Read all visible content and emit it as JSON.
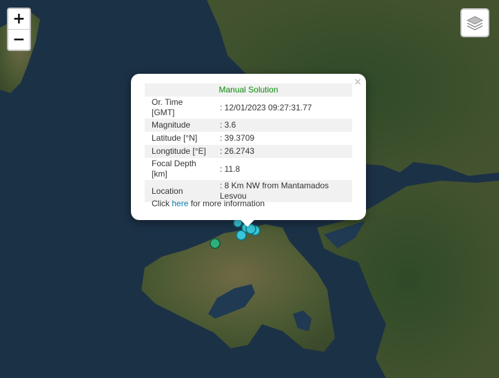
{
  "map": {
    "zoom_in_label": "+",
    "zoom_out_label": "−",
    "colors": {
      "sea": "#1b3146",
      "land_dark": "#3a4f2a",
      "land_light": "#6b6a48",
      "marker_fill": "#38c6d8",
      "marker_outline": "#0e6f7a",
      "marker_old": "#2fae7a"
    }
  },
  "popup": {
    "title": "Manual Solution",
    "close_label": "×",
    "rows": [
      {
        "label": "Or. Time [GMT]",
        "value": ": 12/01/2023 09:27:31.77"
      },
      {
        "label": "Magnitude",
        "value": ": 3.6"
      },
      {
        "label": "Latitude [°N]",
        "value": ": 39.3709"
      },
      {
        "label": "Longtitude [°E]",
        "value": ": 26.2743"
      },
      {
        "label": "Focal Depth [km]",
        "value": ": 11.8"
      },
      {
        "label": "Location",
        "value": ": 8 Km NW from Mantamados Lesvou"
      }
    ],
    "info_prefix": "Click ",
    "info_link": "here",
    "info_suffix": " for more information"
  }
}
